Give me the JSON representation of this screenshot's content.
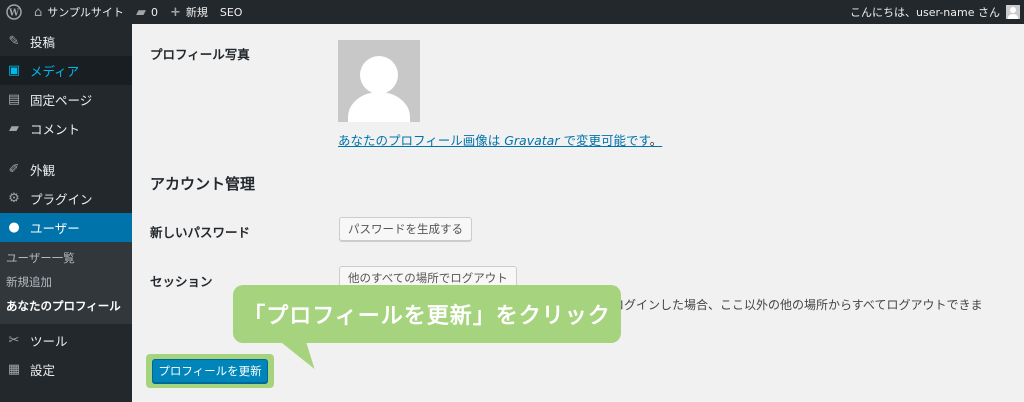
{
  "adminbar": {
    "site_name": "サンプルサイト",
    "comments_count": "0",
    "new_label": "新規",
    "seo_label": "SEO",
    "greeting": "こんにちは、user-name さん"
  },
  "sidebar": {
    "items": [
      {
        "label": "投稿",
        "icon": "pin-icon"
      },
      {
        "label": "メディア",
        "icon": "media-icon"
      },
      {
        "label": "固定ページ",
        "icon": "page-icon"
      },
      {
        "label": "コメント",
        "icon": "comment-icon"
      },
      {
        "label": "外観",
        "icon": "brush-icon"
      },
      {
        "label": "プラグイン",
        "icon": "plugin-icon"
      },
      {
        "label": "ユーザー",
        "icon": "user-icon"
      },
      {
        "label": "ツール",
        "icon": "wrench-icon"
      },
      {
        "label": "設定",
        "icon": "settings-icon"
      }
    ],
    "submenu": [
      "ユーザー一覧",
      "新規追加",
      "あなたのプロフィール"
    ]
  },
  "main": {
    "profile_photo_label": "プロフィール写真",
    "gravatar_text_before": "あなたのプロフィール画像は ",
    "gravatar_link": "Gravatar",
    "gravatar_text_after": " で変更可能です",
    "gravatar_period": "。",
    "account_heading": "アカウント管理",
    "new_password_label": "新しいパスワード",
    "generate_password_button": "パスワードを生成する",
    "session_label": "セッション",
    "logout_everywhere_button": "他のすべての場所でログアウト",
    "session_description": "ログインした場合、ここ以外の他の場所からすべてログアウトできま",
    "update_profile_button": "プロフィールを更新"
  },
  "callout": {
    "text": "「プロフィールを更新」をクリック"
  },
  "colors": {
    "adminbar_bg": "#23282d",
    "sidebar_bg": "#23282d",
    "current_menu_bg": "#0073aa",
    "media_highlight": "#00b9eb",
    "primary_button": "#0085ba",
    "callout_bg": "#a6d37d"
  }
}
